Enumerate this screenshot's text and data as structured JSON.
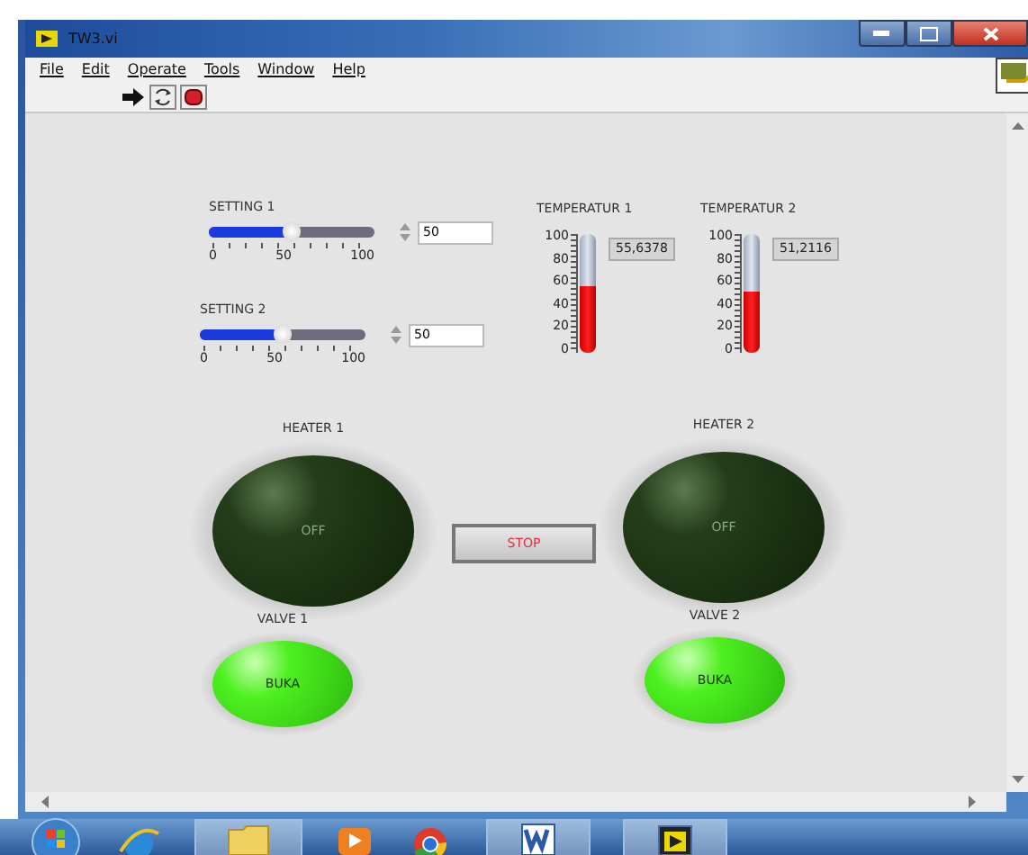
{
  "window": {
    "title": "TW3.vi"
  },
  "menu": [
    "File",
    "Edit",
    "Operate",
    "Tools",
    "Window",
    "Help"
  ],
  "sliders": [
    {
      "label": "SETTING 1",
      "level": 0.5,
      "value": "50",
      "scale": [
        "0",
        "50",
        "100"
      ]
    },
    {
      "label": "SETTING 2",
      "level": 0.5,
      "value": "50",
      "scale": [
        "0",
        "50",
        "100"
      ]
    }
  ],
  "thermometers": [
    {
      "label": "TEMPERATUR  1",
      "level": 0.556,
      "value": "55,6378",
      "scale": [
        "100",
        "80",
        "60",
        "40",
        "20",
        "0"
      ]
    },
    {
      "label": "TEMPERATUR 2",
      "level": 0.512,
      "value": "51,2116",
      "scale": [
        "100",
        "80",
        "60",
        "40",
        "20",
        "0"
      ]
    }
  ],
  "leds": [
    {
      "label": "HEATER 1",
      "text": "OFF",
      "on": false,
      "kind": "large"
    },
    {
      "label": "HEATER 2",
      "text": "OFF",
      "on": false,
      "kind": "large"
    },
    {
      "label": "VALVE 1",
      "text": "BUKA",
      "on": true,
      "kind": "small"
    },
    {
      "label": "VALVE 2",
      "text": "BUKA",
      "on": true,
      "kind": "small"
    }
  ],
  "stop_button": {
    "label": "STOP"
  }
}
